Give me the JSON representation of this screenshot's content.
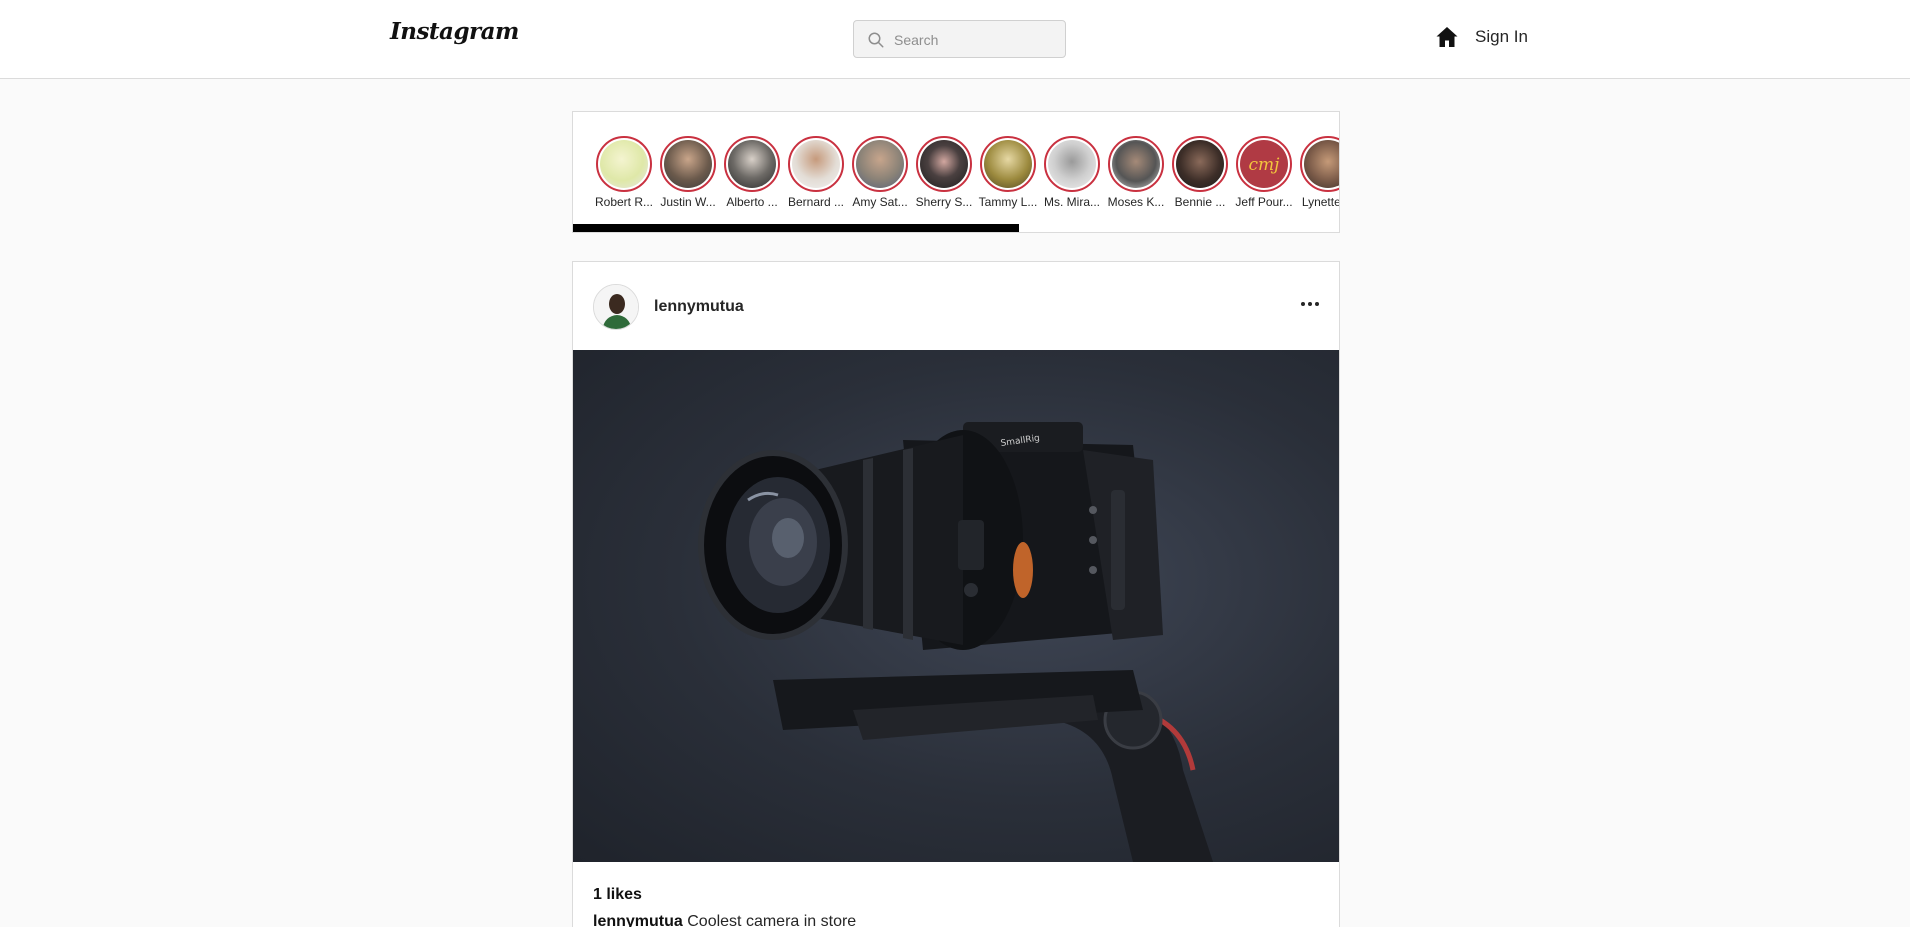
{
  "header": {
    "logo": "Instagram",
    "search_placeholder": "Search",
    "search_icon": "search-icon",
    "home_icon": "home-icon",
    "signin_label": "Sign In"
  },
  "stories": [
    {
      "name": "Robert R...",
      "avatar_color": "#e8e8c8"
    },
    {
      "name": "Justin W...",
      "avatar_color": "#6b5a4c"
    },
    {
      "name": "Alberto ...",
      "avatar_color": "#3a3a3a"
    },
    {
      "name": "Bernard ...",
      "avatar_color": "#d9d2cb"
    },
    {
      "name": "Amy Sat...",
      "avatar_color": "#8a8277"
    },
    {
      "name": "Sherry S...",
      "avatar_color": "#2b2b2b"
    },
    {
      "name": "Tammy L...",
      "avatar_color": "#9c8a3e"
    },
    {
      "name": "Ms. Mira...",
      "avatar_color": "#cfcfcf"
    },
    {
      "name": "Moses K...",
      "avatar_color": "#555555"
    },
    {
      "name": "Bennie ...",
      "avatar_color": "#3d2e28"
    },
    {
      "name": "Jeff Pour...",
      "avatar_color": "#b03a44"
    },
    {
      "name": "Lynette ...",
      "avatar_color": "#7a5a48"
    }
  ],
  "post": {
    "username": "lennymutua",
    "more_icon": "more-horizontal-icon",
    "image_subject": "camera on gimbal",
    "likes_text": "1 likes",
    "caption_user": "lennymutua",
    "caption_text": " Coolest camera in store"
  },
  "colors": {
    "story_ring": "#c93140",
    "background": "#fafafa",
    "border": "#dbdbdb"
  }
}
